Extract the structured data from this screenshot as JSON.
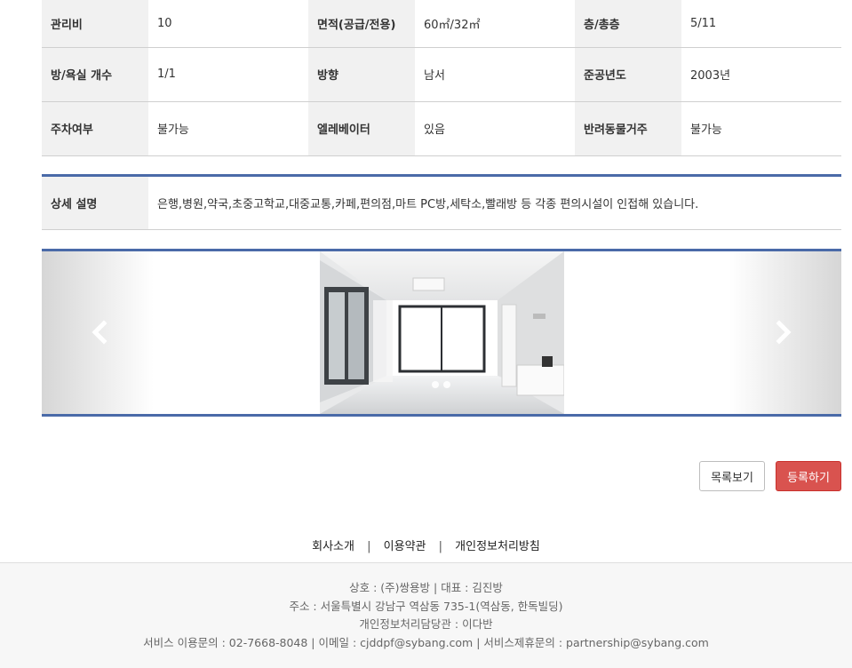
{
  "info_rows": [
    [
      {
        "label": "관리비",
        "value": "10"
      },
      {
        "label": "면적(공급/전용)",
        "value": "60㎡/32㎡"
      },
      {
        "label": "층/총층",
        "value": "5/11"
      }
    ],
    [
      {
        "label": "방/욕실 개수",
        "value": "1/1"
      },
      {
        "label": "방향",
        "value": "남서"
      },
      {
        "label": "준공년도",
        "value": "2003년"
      }
    ],
    [
      {
        "label": "주차여부",
        "value": "불가능"
      },
      {
        "label": "엘레베이터",
        "value": "있음"
      },
      {
        "label": "반려동물거주",
        "value": "불가능"
      }
    ]
  ],
  "detail": {
    "label": "상세 설명",
    "value": "은행,병원,약국,초중고학교,대중교통,카페,편의점,마트 PC방,세탁소,빨래방 등 각종 편의시설이 인접해 있습니다."
  },
  "gallery": {
    "prev_icon": "chevron-left-icon",
    "next_icon": "chevron-right-icon"
  },
  "buttons": {
    "list_label": "목록보기",
    "register_label": "등록하기"
  },
  "footer_links": [
    "회사소개",
    "이용약관",
    "개인정보처리방침"
  ],
  "footer_separator": "|",
  "footer_info": {
    "line1": "상호 : (주)쌍용방 | 대표 : 김진방",
    "line2": "주소 : 서울특별시 강남구 역삼동 735-1(역삼동, 한독빌딩)",
    "line3": "개인정보처리담당관 : 이다반",
    "line4": "서비스 이용문의 : 02-7668-8048 | 이메일 : cjddpf@sybang.com | 서비스제휴문의 : partnership@sybang.com"
  },
  "colors": {
    "accent_border": "#4a6aa8",
    "register_button": "#d9534f",
    "header_cell": "#f1f1f1"
  }
}
